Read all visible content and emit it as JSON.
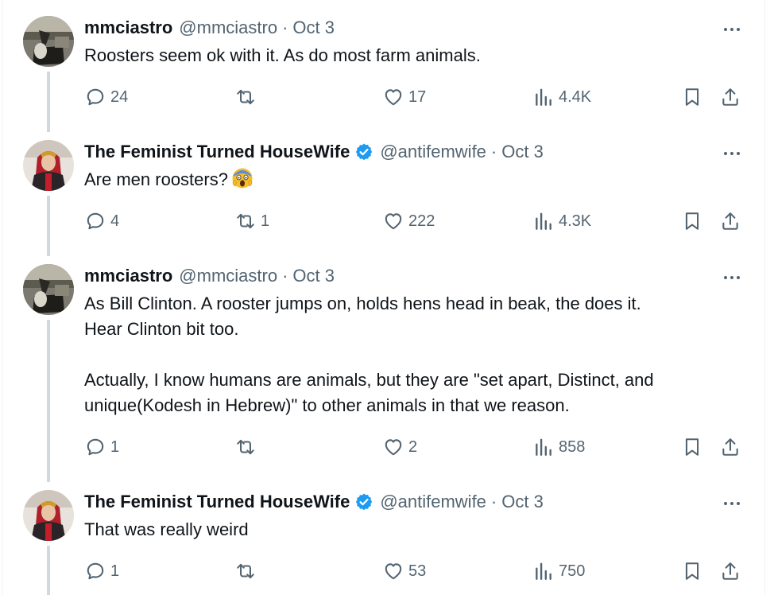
{
  "tweets": [
    {
      "name": "mmciastro",
      "verified": false,
      "handle": "@mmciastro",
      "separator": "·",
      "date": "Oct 3",
      "body": [
        "Roosters seem ok with it.  As do most farm animals."
      ],
      "emoji": null,
      "stats": {
        "replies": "24",
        "retweets": "",
        "likes": "17",
        "views": "4.4K"
      }
    },
    {
      "name": "The Feminist Turned HouseWife",
      "verified": true,
      "handle": "@antifemwife",
      "separator": "·",
      "date": "Oct 3",
      "body": [
        "Are men roosters?"
      ],
      "emoji": "screaming-face-emoji",
      "stats": {
        "replies": "4",
        "retweets": "1",
        "likes": "222",
        "views": "4.3K"
      }
    },
    {
      "name": "mmciastro",
      "verified": false,
      "handle": "@mmciastro",
      "separator": "·",
      "date": "Oct 3",
      "body": [
        "As Bill Clinton.  A rooster jumps on, holds hens head in beak, the does it.",
        "Hear Clinton bit too.",
        "Actually, I know humans are animals, but they are \"set apart, Distinct, and",
        "unique(Kodesh in Hebrew)\" to other animals in that we reason."
      ],
      "emoji": null,
      "stats": {
        "replies": "1",
        "retweets": "",
        "likes": "2",
        "views": "858"
      }
    },
    {
      "name": "The Feminist Turned HouseWife",
      "verified": true,
      "handle": "@antifemwife",
      "separator": "·",
      "date": "Oct 3",
      "body": [
        "That was really weird"
      ],
      "emoji": null,
      "stats": {
        "replies": "1",
        "retweets": "",
        "likes": "53",
        "views": "750"
      }
    }
  ],
  "colors": {
    "text": "#0f1419",
    "secondary": "#536471",
    "verified": "#1d9bf0",
    "thread": "#cfd9de"
  },
  "icons": [
    "more-icon",
    "reply-icon",
    "retweet-icon",
    "like-icon",
    "views-icon",
    "bookmark-icon",
    "share-icon",
    "verified-badge-icon"
  ]
}
